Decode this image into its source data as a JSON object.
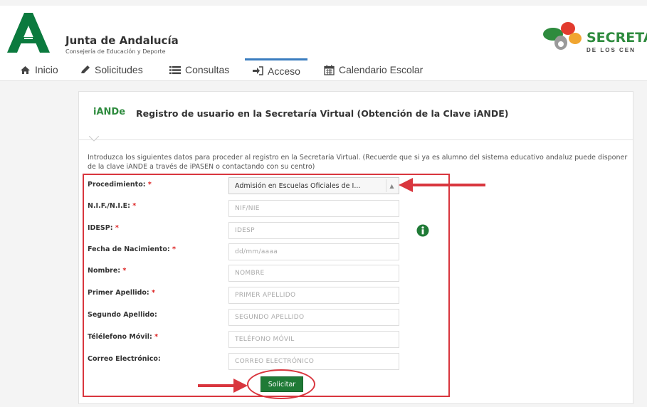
{
  "header": {
    "brand_title": "Junta de Andalucía",
    "brand_subtitle": "Consejería de Educación y Deporte",
    "secretaria_title": "SECRETA",
    "secretaria_subtitle": "DE LOS CEN"
  },
  "nav": {
    "items": [
      {
        "label": "Inicio",
        "icon": "home-icon"
      },
      {
        "label": "Solicitudes",
        "icon": "pencil-icon"
      },
      {
        "label": "Consultas",
        "icon": "list-icon"
      },
      {
        "label": "Acceso",
        "icon": "sign-in-icon",
        "active": true
      },
      {
        "label": "Calendario Escolar",
        "icon": "calendar-icon"
      }
    ]
  },
  "card": {
    "logo_text": "iANDe",
    "title": "Registro de usuario en la Secretaría Virtual (Obtención de la Clave iANDE)",
    "intro": "Introduzca los siguientes datos para proceder al registro en la Secretaría Virtual. (Recuerde que si ya es alumno del sistema educativo andaluz puede disponer de la clave iANDE a través de iPASEN o contactando con su centro)"
  },
  "form": {
    "procedimiento": {
      "label": "Procedimiento:",
      "required": "*",
      "value": "Admisión en Escuelas Oficiales de I..."
    },
    "fields": [
      {
        "label": "N.I.F./N.I.E:",
        "required": "*",
        "placeholder": "NIF/NIE"
      },
      {
        "label": "IDESP:",
        "required": "*",
        "placeholder": "IDESP"
      },
      {
        "label": "Fecha de Nacimiento:",
        "required": "*",
        "placeholder": "dd/mm/aaaa"
      },
      {
        "label": "Nombre:",
        "required": "*",
        "placeholder": "NOMBRE"
      },
      {
        "label": "Primer Apellido:",
        "required": "*",
        "placeholder": "PRIMER APELLIDO"
      },
      {
        "label": "Segundo Apellido:",
        "required": "",
        "placeholder": "SEGUNDO APELLIDO"
      },
      {
        "label": "Télélefono Móvil:",
        "required": "*",
        "placeholder": "TELÉFONO MÓVIL"
      },
      {
        "label": "Correo Electrónico:",
        "required": "",
        "placeholder": "CORREO ELECTRÓNICO"
      }
    ],
    "submit_label": "Solicitar"
  },
  "colors": {
    "brand_green": "#1f7a36",
    "annotation_red": "#d9363e",
    "nav_active": "#3a7dbf"
  }
}
